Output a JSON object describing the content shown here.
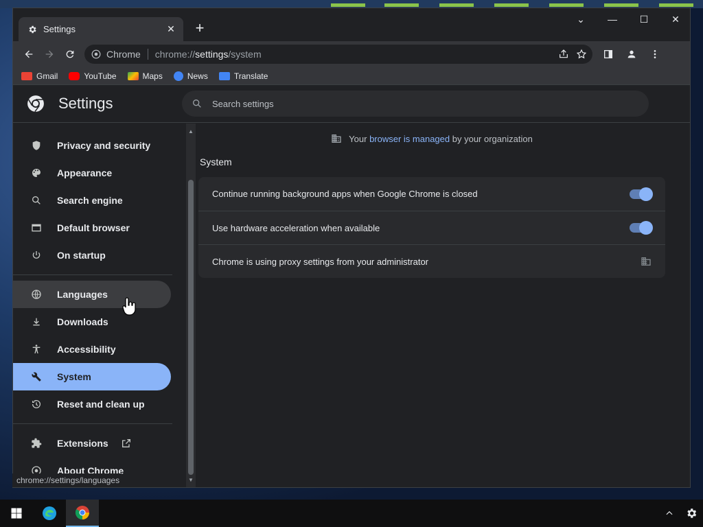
{
  "tab": {
    "title": "Settings",
    "close": "✕",
    "new_tab": "+"
  },
  "window_controls": {
    "dropdown": "⌄",
    "minimize": "—",
    "maximize": "☐",
    "close": "✕"
  },
  "omnibox": {
    "chip": "Chrome",
    "url_prefix": "chrome://",
    "url_host": "settings",
    "url_path": "/system"
  },
  "bookmarks": [
    {
      "label": "Gmail",
      "color": "#ea4335"
    },
    {
      "label": "YouTube",
      "color": "#ff0000"
    },
    {
      "label": "Maps",
      "color": "#34a853"
    },
    {
      "label": "News",
      "color": "#4285f4"
    },
    {
      "label": "Translate",
      "color": "#4285f4"
    }
  ],
  "settings": {
    "title": "Settings",
    "search_placeholder": "Search settings"
  },
  "sidebar": {
    "items": [
      {
        "label": "Privacy and security",
        "icon": "shield-icon"
      },
      {
        "label": "Appearance",
        "icon": "palette-icon"
      },
      {
        "label": "Search engine",
        "icon": "search-icon"
      },
      {
        "label": "Default browser",
        "icon": "browser-icon"
      },
      {
        "label": "On startup",
        "icon": "power-icon"
      },
      {
        "label": "Languages",
        "icon": "globe-icon"
      },
      {
        "label": "Downloads",
        "icon": "download-icon"
      },
      {
        "label": "Accessibility",
        "icon": "accessibility-icon"
      },
      {
        "label": "System",
        "icon": "wrench-icon"
      },
      {
        "label": "Reset and clean up",
        "icon": "history-icon"
      },
      {
        "label": "Extensions",
        "icon": "puzzle-icon"
      },
      {
        "label": "About Chrome",
        "icon": "chrome-icon"
      }
    ],
    "hovered": "Languages",
    "selected": "System"
  },
  "main": {
    "managed_prefix": "Your",
    "managed_link": "browser is managed",
    "managed_suffix": "by your organization",
    "section_title": "System",
    "rows": [
      {
        "label": "Continue running background apps when Google Chrome is closed",
        "control": "toggle",
        "on": true
      },
      {
        "label": "Use hardware acceleration when available",
        "control": "toggle",
        "on": true
      },
      {
        "label": "Chrome is using proxy settings from your administrator",
        "control": "building-icon"
      }
    ]
  },
  "status_bar": {
    "text": "chrome://settings/languages"
  },
  "colors": {
    "accent": "#8ab4f8",
    "background": "#202124",
    "card": "#292a2d"
  }
}
